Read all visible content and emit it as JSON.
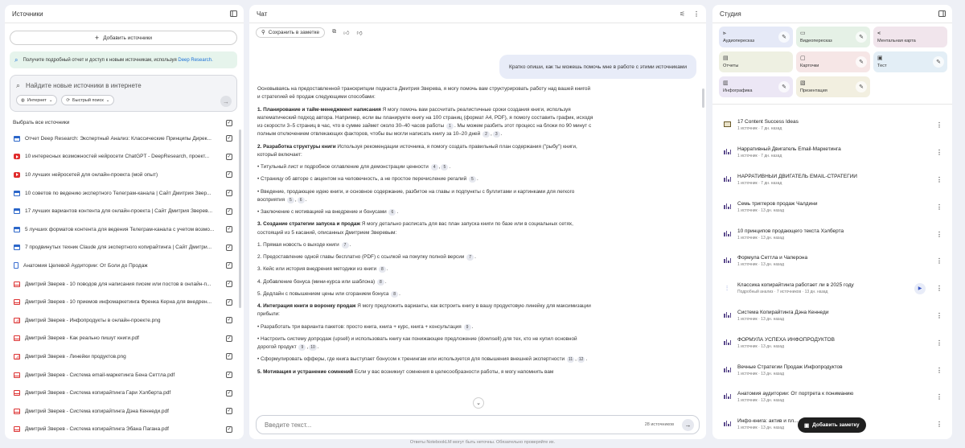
{
  "sources": {
    "title": "Источники",
    "add_label": "Добавить источники",
    "promo_text": "Получите подробный отчет и доступ к новым источникам, используя ",
    "promo_link": "Deep Research.",
    "search_placeholder": "Найдите новые источники в интернете",
    "chip_web": "Интернет",
    "chip_fast": "Быстрый поиск",
    "select_all": "Выбрать все источники",
    "items": [
      {
        "type": "web",
        "title": "Отчет Deep Research: Экспертный Анализ: Классические Принципы Дирек..."
      },
      {
        "type": "yt",
        "title": "10 интересных возможностей нейросети ChatGPT - DeepResearch, проект..."
      },
      {
        "type": "yt",
        "title": "10 лучших нейросетей для онлайн-проекта (мой опыт)"
      },
      {
        "type": "web",
        "title": "10 советов по ведению экспертного Телеграм-канала | Сайт Дмитрия Звер..."
      },
      {
        "type": "web",
        "title": "17 лучших вариантов контента для онлайн-проекта | Сайт Дмитрия Зверев..."
      },
      {
        "type": "web",
        "title": "5 лучших форматов контента для ведения Телеграм-канала с учетом возмо..."
      },
      {
        "type": "web",
        "title": "7 продвинутых техник Claude для экспертного копирайтинга | Сайт Дмитри..."
      },
      {
        "type": "doc",
        "title": "Анатомия Целевой Аудитории: От Боли до Продаж"
      },
      {
        "type": "pdf",
        "title": "Дмитрий Зверев - 10 поводов для написания писем или постов в онлайн-п..."
      },
      {
        "type": "pdf",
        "title": "Дмитрий Зверев - 10 приемов инфомаркетинга Френка Керна для внедрен..."
      },
      {
        "type": "img",
        "title": "Дмитрий Зверев - Инфопродукты в онлайн-проекте.png"
      },
      {
        "type": "pdf",
        "title": "Дмитрий Зверев - Как реально пишут книги.pdf"
      },
      {
        "type": "img",
        "title": "Дмитрий Зверев - Линейки продуктов.png"
      },
      {
        "type": "pdf",
        "title": "Дмитрий Зверев - Система email-маркетинга Бена Сеттла.pdf"
      },
      {
        "type": "pdf",
        "title": "Дмитрий Зверев - Система копирайтинга Гари Хэлберта.pdf"
      },
      {
        "type": "pdf",
        "title": "Дмитрий Зверев - Система копирайтинга Дэна Кеннеди.pdf"
      },
      {
        "type": "pdf",
        "title": "Дмитрий Зверев - Система копирайтинга Эбана Пагана.pdf"
      }
    ]
  },
  "chat": {
    "title": "Чат",
    "save_label": "Сохранить в заметке",
    "user_message": "Кратко опиши, как ты можешь помочь мне в работе с этими источниками",
    "intro": "Основываясь на предоставленной транскрипции подкаста Дмитрия Зверева, я могу помочь вам структурировать работу над вашей книгой и стратегией её продаж следующими способами:",
    "s1_title": "1. Планирование и тайм-менеджмент написания",
    "s1_text": " Я могу помочь вам рассчитать реалистичные сроки создания книги, используя математический подход автора. Например, если вы планируете книгу на 100 страниц (формат A4, PDF), я помогу составить график, исходя из скорости 3–5 страниц в час, что в сумме займет около 30–40 часов работы ",
    "s1_text2": ". Мы можем разбить этот процесс на блоки по 90 минут с полным отключением отвлекающих факторов, чтобы вы могли написать книгу за 10–20 дней ",
    "s2_title": "2. Разработка структуры книги",
    "s2_text": " Используя рекомендации источника, я помогу создать правильный план содержания (\"рыбу\") книги, который включает:",
    "s2_b1": "• Титульный лист и подробное оглавление для демонстрации ценности ",
    "s2_b2": "• Страницу об авторе с акцентом на человечность, а не простое перечисление регалий ",
    "s2_b3": "• Введение, продающее идею книги, и основное содержание, разбитое на главы и подпункты с буллитами и картинками для легкого восприятия ",
    "s2_b4": "• Заключение с мотивацией на внедрение и бонусами ",
    "s3_title": "3. Создание стратегии запуска и продаж",
    "s3_text": " Я могу детально расписать для вас план запуска книги по базе или в социальных сетях, состоящий из 5 касаний, описанных Дмитрием Зверевым:",
    "s3_l1": "1. Прямая новость о выходе книги ",
    "s3_l2": "2. Предоставление одной главы бесплатно (PDF) с ссылкой на покупку полной версии ",
    "s3_l3": "3. Кейс или история внедрения методики из книги ",
    "s3_l4": "4. Добавление бонуса (мини-курса или шаблона) ",
    "s3_l5": "5. Дедлайн с повышением цены или сгоранием бонуса ",
    "s4_title": "4. Интеграция книги в воронку продаж",
    "s4_text": " Я могу предложить варианты, как встроить книгу в вашу продуктовую линейку для максимизации прибыли:",
    "s4_b1": "• Разработать три варианта пакетов: просто книга, книга + курс, книга + консультация ",
    "s4_b2": "• Настроить систему допродаж (upsell) и использовать книгу как понижающее предложение (downsell) для тех, кто не купил основной дорогой продукт ",
    "s4_b3": "• Сформулировать офферы, где книга выступает бонусом к тренингам или используется для повышения внешней экспертности ",
    "s5_title": "5. Мотивация и устранение сомнений",
    "s5_text": " Если у вас возникнут сомнения в целесообразности работы, я могу напомнить вам",
    "c": {
      "s1a": "1",
      "s1b": "2",
      "s1c": "3",
      "b1a": "4",
      "b1b": "5",
      "b2": "5",
      "b3a": "5",
      "b3b": "6",
      "b4": "6",
      "l1": "7",
      "l2": "7",
      "l3": "8",
      "l4": "8",
      "l5": "8",
      "d1": "9",
      "d2a": "9",
      "d2b": "10",
      "d3a": "11",
      "d3b": "12"
    },
    "input_placeholder": "Введите текст...",
    "source_count": "28 источников"
  },
  "studio": {
    "title": "Студия",
    "tiles": [
      {
        "label": "Аудиопересказ",
        "icon": "audio-wave-icon",
        "bg": "#e5e9f7",
        "pen": true
      },
      {
        "label": "Видеопересказ",
        "icon": "video-icon",
        "bg": "#e5f1e6",
        "pen": true
      },
      {
        "label": "Ментальная карта",
        "icon": "mindmap-icon",
        "bg": "#f1e5ec",
        "pen": false
      },
      {
        "label": "Отчеты",
        "icon": "report-icon",
        "bg": "#eef0e2",
        "pen": false
      },
      {
        "label": "Карточки",
        "icon": "cards-icon",
        "bg": "#f6e6e6",
        "pen": true
      },
      {
        "label": "Тест",
        "icon": "quiz-icon",
        "bg": "#e3eef6",
        "pen": true
      },
      {
        "label": "Инфографика",
        "icon": "infographic-icon",
        "bg": "#ece7f5",
        "pen": true
      },
      {
        "label": "Презентация",
        "icon": "presentation-icon",
        "bg": "#f2efe0",
        "pen": true
      }
    ],
    "notes": [
      {
        "icon": "video",
        "title": "17 Content Success Ideas",
        "meta": "1 источник · 7 дн. назад"
      },
      {
        "icon": "audio",
        "title": "Нарративный Двигатель Email-Маркетинга",
        "meta": "1 источник · 7 дн. назад"
      },
      {
        "icon": "audio",
        "title": "НАРРАТИВНЫЙ ДВИГАТЕЛЬ EMAIL-СТРАТЕГИИ",
        "meta": "1 источник · 7 дн. назад"
      },
      {
        "icon": "audio",
        "title": "Семь триггеров продаж Чалдини",
        "meta": "1 источник · 13 дн. назад"
      },
      {
        "icon": "audio",
        "title": "10 принципов продающего текста Хэлберта",
        "meta": "1 источник · 13 дн. назад"
      },
      {
        "icon": "audio",
        "title": "Формула Сеттла и Чаперона",
        "meta": "1 источник · 13 дн. назад"
      },
      {
        "icon": "wave",
        "title": "Классика копирайтинга работает ли в 2025 году",
        "meta": "Подробный анализ · 7 источников · 13 дн. назад",
        "play": true
      },
      {
        "icon": "audio",
        "title": "Система Копирайтинга Дэна Кеннеди",
        "meta": "1 источник · 13 дн. назад"
      },
      {
        "icon": "audio",
        "title": "ФОРМУЛА УСПЕХА ИНФОПРОДУКТОВ",
        "meta": "1 источник · 13 дн. назад"
      },
      {
        "icon": "audio",
        "title": "Вечные Стратегии Продаж Инфопродуктов",
        "meta": "1 источник · 13 дн. назад"
      },
      {
        "icon": "audio",
        "title": "Анатомия аудитории: От портрета к пониманию",
        "meta": "1 источник · 13 дн. назад"
      },
      {
        "icon": "audio",
        "title": "Инфо-книга: актив и пл...",
        "meta": "1 источник · 13 дн. назад"
      }
    ],
    "add_note_label": "Добавить заметку"
  },
  "footer": "Ответы NotebookLM могут быть неточны. Обязательно проверяйте их."
}
